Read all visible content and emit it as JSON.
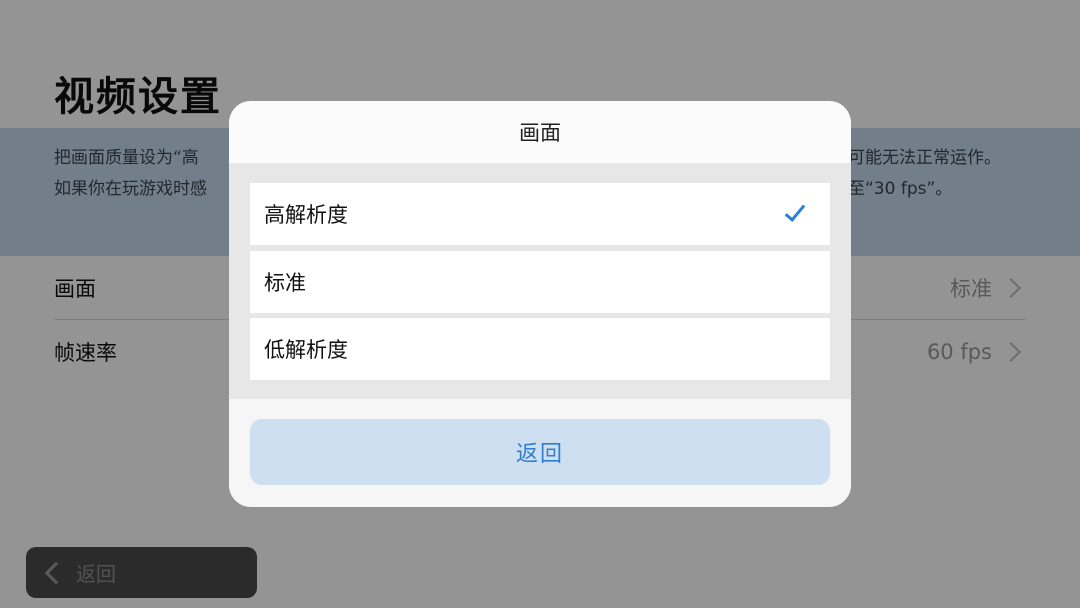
{
  "page": {
    "title": "视频设置",
    "description_line1_start": "把画面质量设为“高",
    "description_line1_end": "可能无法正常运作。",
    "description_line2_start": "如果你在玩游戏时感",
    "description_line2_end": "至“30 fps”。"
  },
  "settings": [
    {
      "label": "画面",
      "value": "标准"
    },
    {
      "label": "帧速率",
      "value": "60 fps"
    }
  ],
  "bottom_bar": {
    "back_label": "返回"
  },
  "dialog": {
    "title": "画面",
    "options": [
      {
        "label": "高解析度",
        "selected": true
      },
      {
        "label": "标准",
        "selected": false
      },
      {
        "label": "低解析度",
        "selected": false
      }
    ],
    "back_label": "返回"
  },
  "colors": {
    "accent": "#2a7fd6",
    "description_band": "#c4d9ec",
    "back_button_bg": "#cddff0"
  }
}
